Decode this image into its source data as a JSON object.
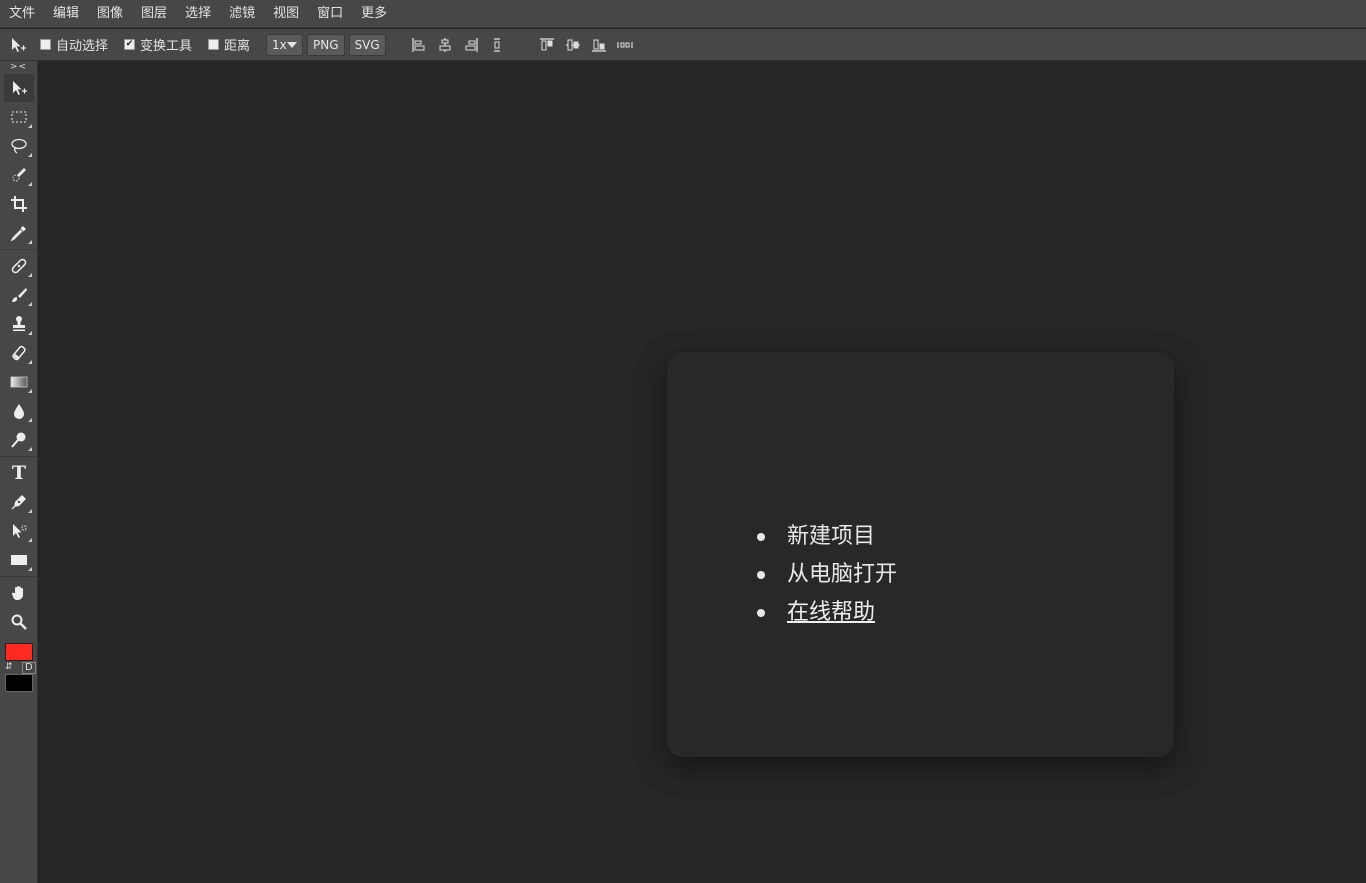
{
  "menubar": {
    "items": [
      "文件",
      "编辑",
      "图像",
      "图层",
      "选择",
      "滤镜",
      "视图",
      "窗口",
      "更多"
    ]
  },
  "options": {
    "auto_select": {
      "label": "自动选择",
      "checked": false
    },
    "transform": {
      "label": "变换工具",
      "checked": true
    },
    "distance": {
      "label": "距离",
      "checked": false
    },
    "scale": "1x",
    "png_label": "PNG",
    "svg_label": "SVG",
    "check_mark": "✔"
  },
  "toolbox": {
    "collapse_label": "><",
    "text_tool_glyph": "T",
    "swap_glyph": "⇵",
    "default_label": "D",
    "foreground_color": "#ff2a1f",
    "background_color": "#000000"
  },
  "dialog": {
    "items": [
      {
        "label": "新建项目",
        "link": false
      },
      {
        "label": "从电脑打开",
        "link": false
      },
      {
        "label": "在线帮助",
        "link": true
      }
    ]
  }
}
